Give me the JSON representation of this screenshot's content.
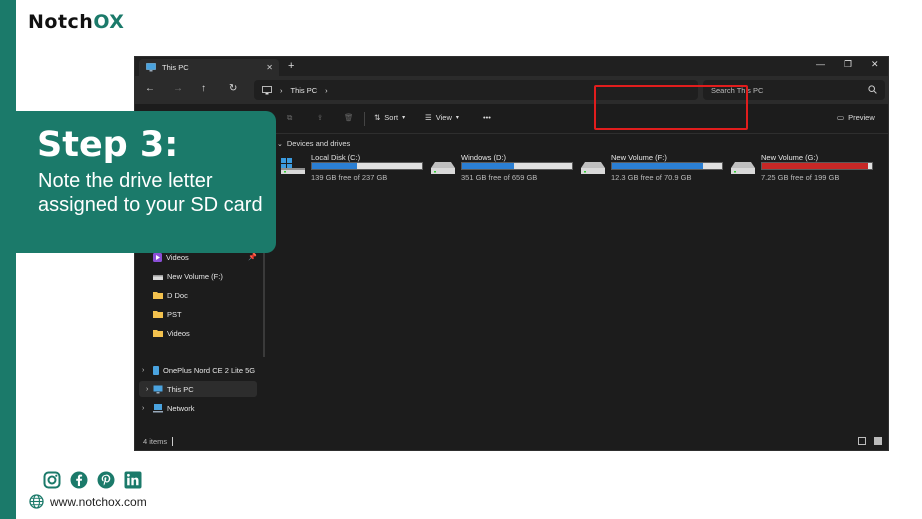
{
  "brand": {
    "name_part1": "Notch",
    "name_part2": "OX"
  },
  "window": {
    "tab_title": "This PC",
    "new_tab_label": "+",
    "breadcrumb": "This PC",
    "search_placeholder": "Search This PC",
    "toolbar": {
      "sort_label": "Sort",
      "view_label": "View",
      "more_label": "•••",
      "preview_label": "Preview"
    },
    "sidebar": {
      "items": [
        {
          "label": "Videos"
        },
        {
          "label": "New Volume (F:)"
        },
        {
          "label": "D Doc"
        },
        {
          "label": "PST"
        },
        {
          "label": "Videos"
        },
        {
          "label": "OnePlus Nord CE 2 Lite 5G"
        },
        {
          "label": "This PC"
        },
        {
          "label": "Network"
        }
      ]
    },
    "section_header": "Devices and drives",
    "drives": [
      {
        "name": "Local Disk (C:)",
        "free": "139 GB free of 237 GB",
        "used_fraction": 0.41
      },
      {
        "name": "Windows (D:)",
        "free": "351 GB free of 659 GB",
        "used_fraction": 0.47
      },
      {
        "name": "New Volume (F:)",
        "free": "12.3 GB free of 70.9 GB",
        "used_fraction": 0.83
      },
      {
        "name": "New Volume (G:)",
        "free": "7.25 GB free of 199 GB",
        "used_fraction": 0.96
      }
    ],
    "status": "4 items"
  },
  "step": {
    "title": "Step 3:",
    "description": "Note the drive letter assigned to your SD card"
  },
  "website": "www.notchox.com",
  "colors": {
    "brand_teal": "#1b7a6a",
    "highlight_red": "#e11d1d",
    "drive_blue": "#2b7fd3",
    "drive_full_red": "#c72826"
  }
}
